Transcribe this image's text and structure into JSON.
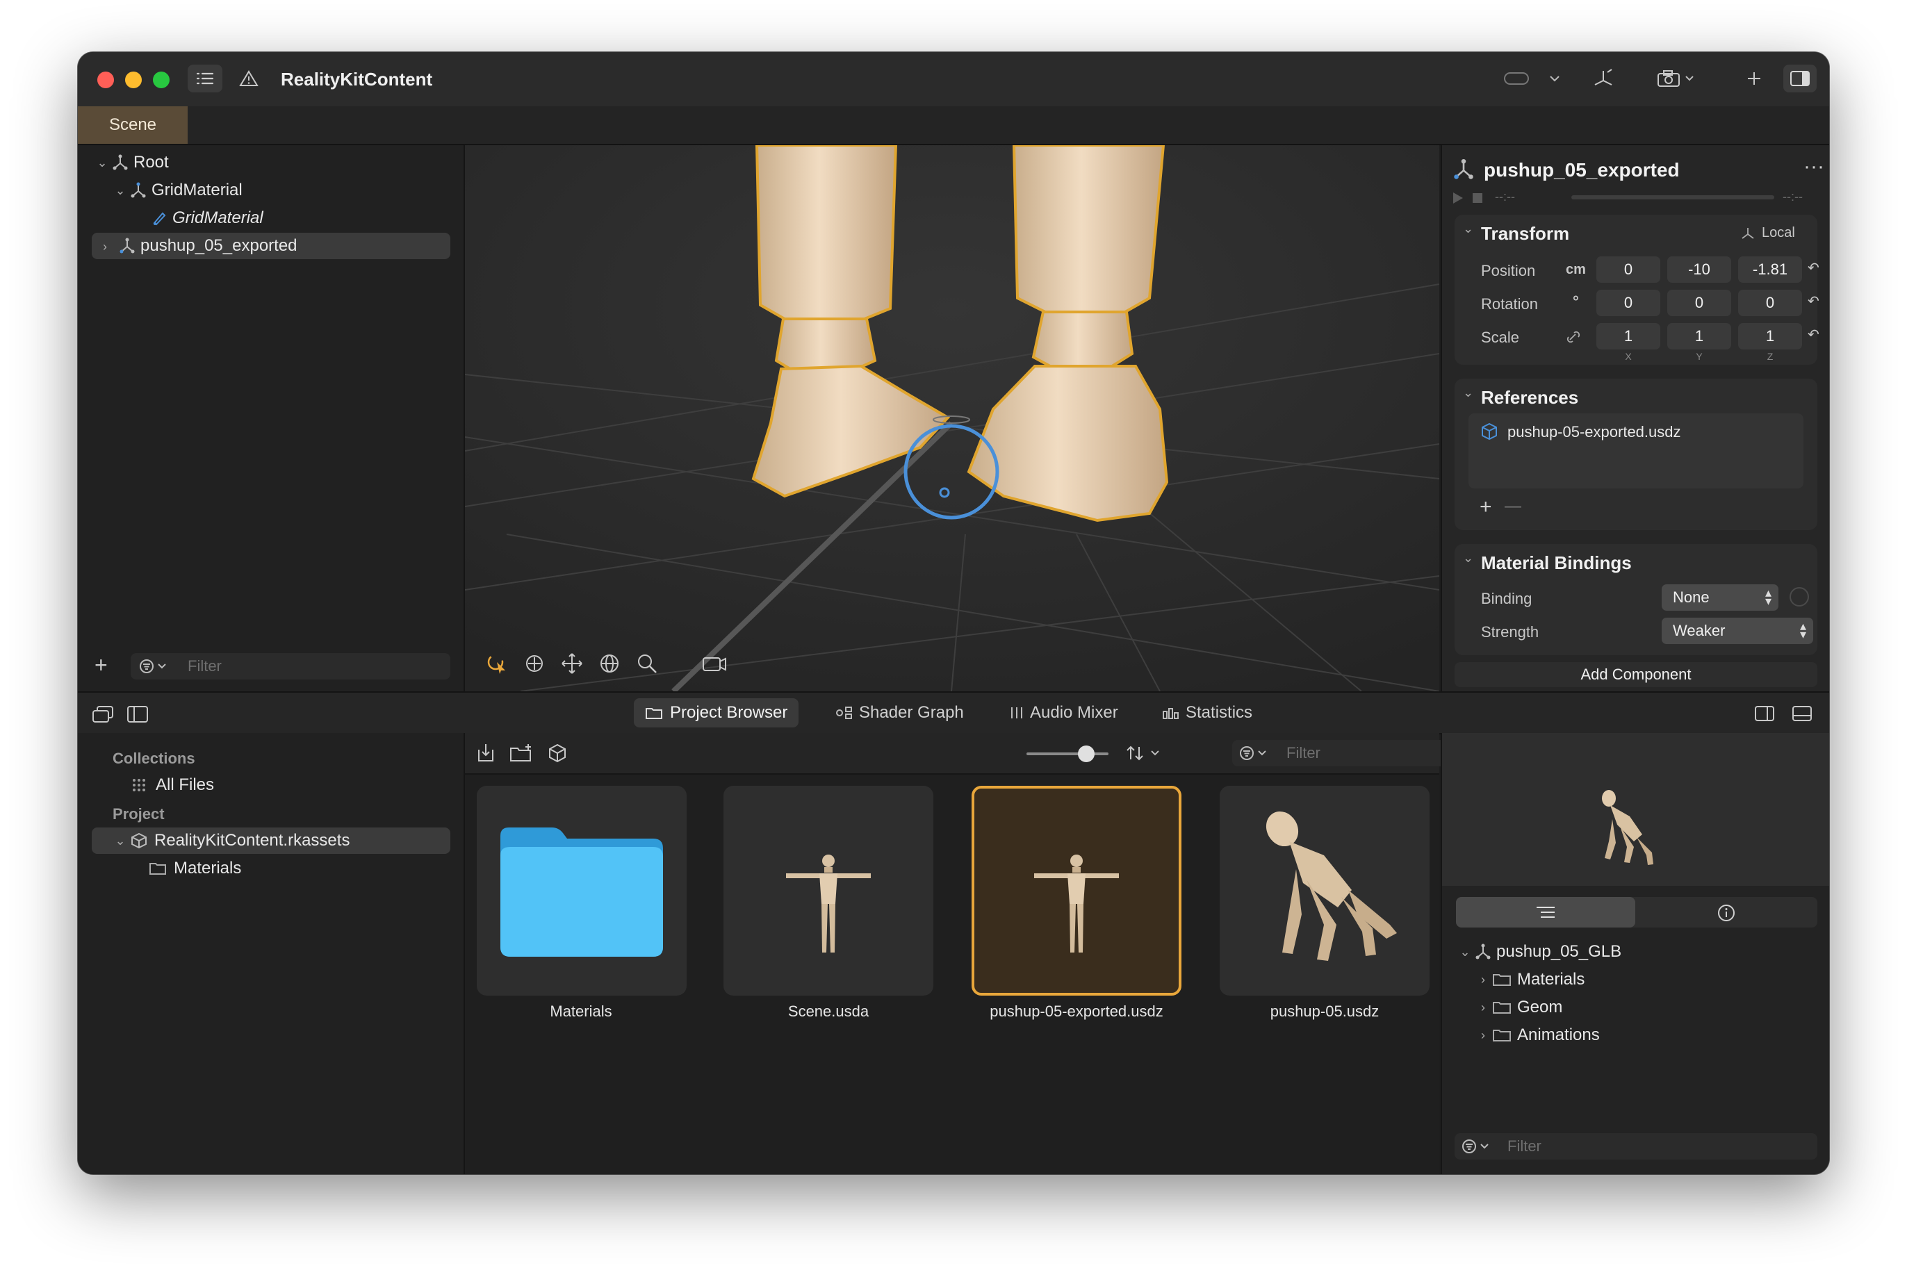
{
  "window": {
    "title": "RealityKitContent"
  },
  "tabs": {
    "scene": "Scene"
  },
  "outline": {
    "items": [
      {
        "label": "Root"
      },
      {
        "label": "GridMaterial"
      },
      {
        "label": "GridMaterial"
      },
      {
        "label": "pushup_05_exported"
      }
    ],
    "filter_placeholder": "Filter"
  },
  "inspector": {
    "entity_name": "pushup_05_exported",
    "timeline_start": "--:--",
    "timeline_end": "--:--",
    "transform": {
      "title": "Transform",
      "space": "Local",
      "position_label": "Position",
      "position_unit": "cm",
      "position": [
        "0",
        "-10",
        "-1.81"
      ],
      "rotation_label": "Rotation",
      "rotation_unit": "°",
      "rotation": [
        "0",
        "0",
        "0"
      ],
      "scale_label": "Scale",
      "scale": [
        "1",
        "1",
        "1"
      ],
      "axes": [
        "X",
        "Y",
        "Z"
      ]
    },
    "references": {
      "title": "References",
      "file": "pushup-05-exported.usdz",
      "add": "+",
      "remove": "—"
    },
    "material_bindings": {
      "title": "Material Bindings",
      "binding_label": "Binding",
      "binding_value": "None",
      "strength_label": "Strength",
      "strength_value": "Weaker"
    },
    "add_component": "Add Component"
  },
  "bottom_tabs": [
    "Project Browser",
    "Shader Graph",
    "Audio Mixer",
    "Statistics"
  ],
  "sidebar": {
    "collections_header": "Collections",
    "all_files": "All Files",
    "project_header": "Project",
    "rkassets": "RealityKitContent.rkassets",
    "materials": "Materials"
  },
  "browser": {
    "filter_placeholder": "Filter",
    "zoom_level": 0.5,
    "items": [
      {
        "label": "Materials",
        "kind": "folder"
      },
      {
        "label": "Scene.usda",
        "kind": "tpose"
      },
      {
        "label": "pushup-05-exported.usdz",
        "kind": "tpose",
        "selected": true
      },
      {
        "label": "pushup-05.usdz",
        "kind": "pushup"
      }
    ]
  },
  "preview": {
    "root": "pushup_05_GLB",
    "children": [
      "Materials",
      "Geom",
      "Animations"
    ],
    "filter_placeholder": "Filter"
  },
  "colors": {
    "accent_orange": "#e9a73b",
    "selection_blue": "#4a90d9",
    "folder_blue": "#45b6f0"
  }
}
